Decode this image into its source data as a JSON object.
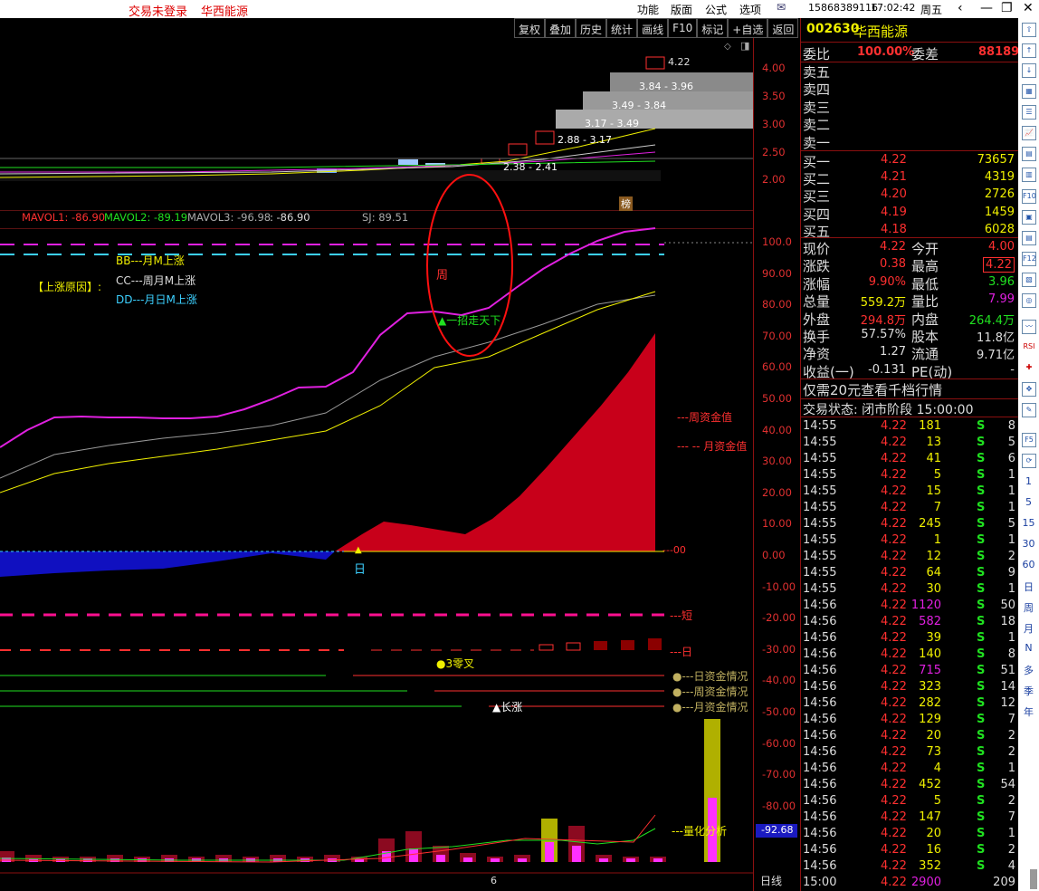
{
  "topbar": {
    "status": "交易未登录",
    "stock_name": "华西能源",
    "menus": [
      "功能",
      "版面",
      "公式",
      "选项"
    ],
    "account": "15868389116",
    "time": "17:02:42",
    "weekday": "周五"
  },
  "toolbar": [
    "复权",
    "叠加",
    "历史",
    "统计",
    "画线",
    "F10",
    "标记",
    "+自选",
    "返回"
  ],
  "price_axis": [
    "4.00",
    "3.50",
    "3.00",
    "2.50",
    "2.00"
  ],
  "indicator_axis": [
    "100.0",
    "90.00",
    "80.00",
    "70.00",
    "60.00",
    "50.00",
    "40.00",
    "30.00",
    "20.00",
    "10.00",
    "0.00",
    "-10.00",
    "-20.00",
    "-30.00",
    "-40.00",
    "-50.00",
    "-60.00",
    "-70.00",
    "-80.00"
  ],
  "price_labels": {
    "high": "4.22",
    "r1": "3.84 - 3.96",
    "r2": "3.49 - 3.84",
    "r3": "3.17 - 3.49",
    "r4": "2.88 - 3.17",
    "r5": "2.38 - 2.41",
    "bang": "榜"
  },
  "mavol": {
    "ma1": "MAVOL1: -86.90",
    "ma2": "MAVOL2: -89.19",
    "ma3": "MAVOL3: -96.98",
    "val": ": -86.90",
    "sj": "SJ: 89.51"
  },
  "legend": {
    "reason": "【上涨原因】:",
    "bb": "BB---月M上涨",
    "cc": "CC---周月M上涨",
    "dd": "DD---月日M上涨"
  },
  "annot": {
    "zhou": "周",
    "yizhao": "▲一招走天下",
    "ri": "日",
    "zhou_fund": "---周资金值",
    "yue_fund": "--- -- 月资金值",
    "zero": "---00",
    "duan": "---短",
    "ri2": "---日",
    "sanlingcha": "●3零叉",
    "ri_fund": "●---日资金情况",
    "zhou_fund2": "●---周资金情况",
    "yue_fund2": "●---月资金情况",
    "changzhang": "▲长涨",
    "lianghua": "---量化分析",
    "vol_val": "-92.68",
    "day_mark": "6",
    "period": "日线"
  },
  "quote": {
    "code": "002630",
    "name": "华西能源",
    "weibi_label": "委比",
    "weibi": "100.00%",
    "weicha_label": "委差",
    "weicha": "88189",
    "sell": [
      {
        "l": "卖五"
      },
      {
        "l": "卖四"
      },
      {
        "l": "卖三"
      },
      {
        "l": "卖二"
      },
      {
        "l": "卖一"
      }
    ],
    "buy": [
      {
        "l": "买一",
        "p": "4.22",
        "v": "73657"
      },
      {
        "l": "买二",
        "p": "4.21",
        "v": "4319"
      },
      {
        "l": "买三",
        "p": "4.20",
        "v": "2726"
      },
      {
        "l": "买四",
        "p": "4.19",
        "v": "1459"
      },
      {
        "l": "买五",
        "p": "4.18",
        "v": "6028"
      }
    ],
    "stats": [
      [
        "现价",
        "4.22",
        "今开",
        "4.00"
      ],
      [
        "涨跌",
        "0.38",
        "最高",
        "4.22"
      ],
      [
        "涨幅",
        "9.90%",
        "最低",
        "3.96"
      ],
      [
        "总量",
        "559.2万",
        "量比",
        "7.99"
      ],
      [
        "外盘",
        "294.8万",
        "内盘",
        "264.4万"
      ],
      [
        "换手",
        "57.57%",
        "股本",
        "11.8亿"
      ],
      [
        "净资",
        "1.27",
        "流通",
        "9.71亿"
      ],
      [
        "收益(一)",
        "-0.131",
        "PE(动)",
        "-"
      ]
    ],
    "promo": "仅需20元查看千档行情",
    "trade_state": "交易状态: 闭市阶段 15:00:00"
  },
  "ticks": [
    [
      "14:55",
      "4.22",
      "181",
      "S",
      "8"
    ],
    [
      "14:55",
      "4.22",
      "13",
      "S",
      "5"
    ],
    [
      "14:55",
      "4.22",
      "41",
      "S",
      "6"
    ],
    [
      "14:55",
      "4.22",
      "5",
      "S",
      "1"
    ],
    [
      "14:55",
      "4.22",
      "15",
      "S",
      "1"
    ],
    [
      "14:55",
      "4.22",
      "7",
      "S",
      "1"
    ],
    [
      "14:55",
      "4.22",
      "245",
      "S",
      "5"
    ],
    [
      "14:55",
      "4.22",
      "1",
      "S",
      "1"
    ],
    [
      "14:55",
      "4.22",
      "12",
      "S",
      "2"
    ],
    [
      "14:55",
      "4.22",
      "64",
      "S",
      "9"
    ],
    [
      "14:55",
      "4.22",
      "30",
      "S",
      "1"
    ],
    [
      "14:56",
      "4.22",
      "1120",
      "S",
      "50"
    ],
    [
      "14:56",
      "4.22",
      "582",
      "S",
      "18"
    ],
    [
      "14:56",
      "4.22",
      "39",
      "S",
      "1"
    ],
    [
      "14:56",
      "4.22",
      "140",
      "S",
      "8"
    ],
    [
      "14:56",
      "4.22",
      "715",
      "S",
      "51"
    ],
    [
      "14:56",
      "4.22",
      "323",
      "S",
      "14"
    ],
    [
      "14:56",
      "4.22",
      "282",
      "S",
      "12"
    ],
    [
      "14:56",
      "4.22",
      "129",
      "S",
      "7"
    ],
    [
      "14:56",
      "4.22",
      "20",
      "S",
      "2"
    ],
    [
      "14:56",
      "4.22",
      "73",
      "S",
      "2"
    ],
    [
      "14:56",
      "4.22",
      "4",
      "S",
      "1"
    ],
    [
      "14:56",
      "4.22",
      "452",
      "S",
      "54"
    ],
    [
      "14:56",
      "4.22",
      "5",
      "S",
      "2"
    ],
    [
      "14:56",
      "4.22",
      "147",
      "S",
      "7"
    ],
    [
      "14:56",
      "4.22",
      "20",
      "S",
      "1"
    ],
    [
      "14:56",
      "4.22",
      "16",
      "S",
      "2"
    ],
    [
      "14:56",
      "4.22",
      "352",
      "S",
      "4"
    ],
    [
      "15:00",
      "4.22",
      "2900",
      "",
      "209"
    ]
  ],
  "side_periods": [
    "1",
    "5",
    "15",
    "30",
    "60",
    "日",
    "周",
    "月",
    "N",
    "多",
    "季",
    "年"
  ],
  "colors": {
    "up": "#ff3030",
    "accent": "#f0f000",
    "magenta": "#e020e0",
    "green": "#20e020"
  }
}
